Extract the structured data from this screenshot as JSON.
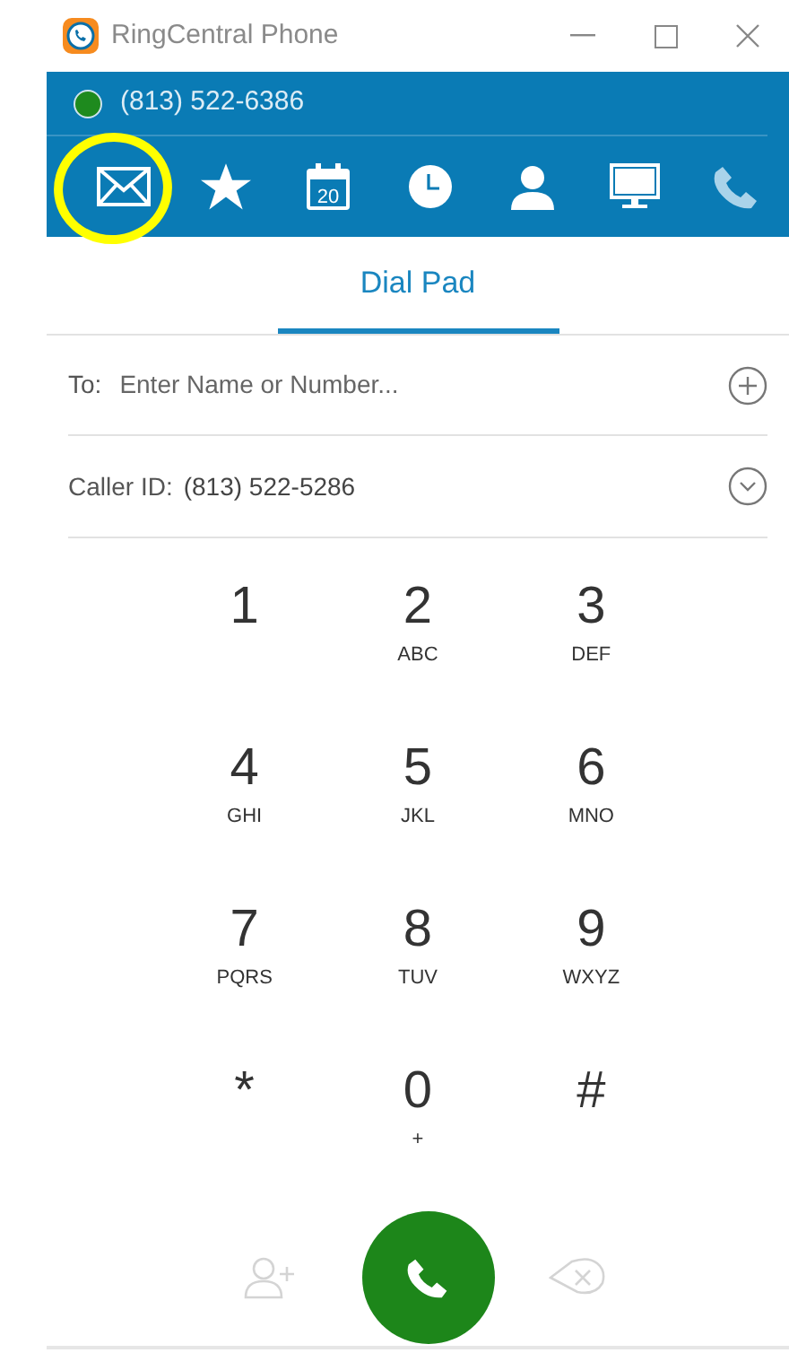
{
  "window": {
    "title": "RingCentral Phone"
  },
  "status": {
    "number": "(813) 522-6386",
    "online": true
  },
  "nav": [
    {
      "kind": "mail",
      "selected": false,
      "highlighted": true
    },
    {
      "kind": "star",
      "selected": false
    },
    {
      "kind": "calendar",
      "label": "20",
      "selected": false
    },
    {
      "kind": "clock",
      "selected": false
    },
    {
      "kind": "person",
      "selected": false
    },
    {
      "kind": "monitor",
      "selected": false
    },
    {
      "kind": "phone",
      "selected": true
    }
  ],
  "tabs": [
    {
      "label": "Dial Pad",
      "selected": true
    }
  ],
  "to": {
    "label": "To:",
    "placeholder": "Enter Name or Number..."
  },
  "caller_id": {
    "label": "Caller ID:",
    "value": "(813) 522-5286"
  },
  "keys": [
    {
      "digit": "1"
    },
    {
      "digit": "2",
      "letters": "ABC"
    },
    {
      "digit": "3",
      "letters": "DEF"
    },
    {
      "digit": "4",
      "letters": "GHI"
    },
    {
      "digit": "5",
      "letters": "JKL"
    },
    {
      "digit": "6",
      "letters": "MNO"
    },
    {
      "digit": "7",
      "letters": "PQRS"
    },
    {
      "digit": "8",
      "letters": "TUV"
    },
    {
      "digit": "9",
      "letters": "WXYZ"
    },
    {
      "digit": "*"
    },
    {
      "digit": "0",
      "letters": "+"
    },
    {
      "digit": "#"
    }
  ],
  "add_contact": {
    "disabled": true
  },
  "backspace": {
    "disabled": true
  }
}
